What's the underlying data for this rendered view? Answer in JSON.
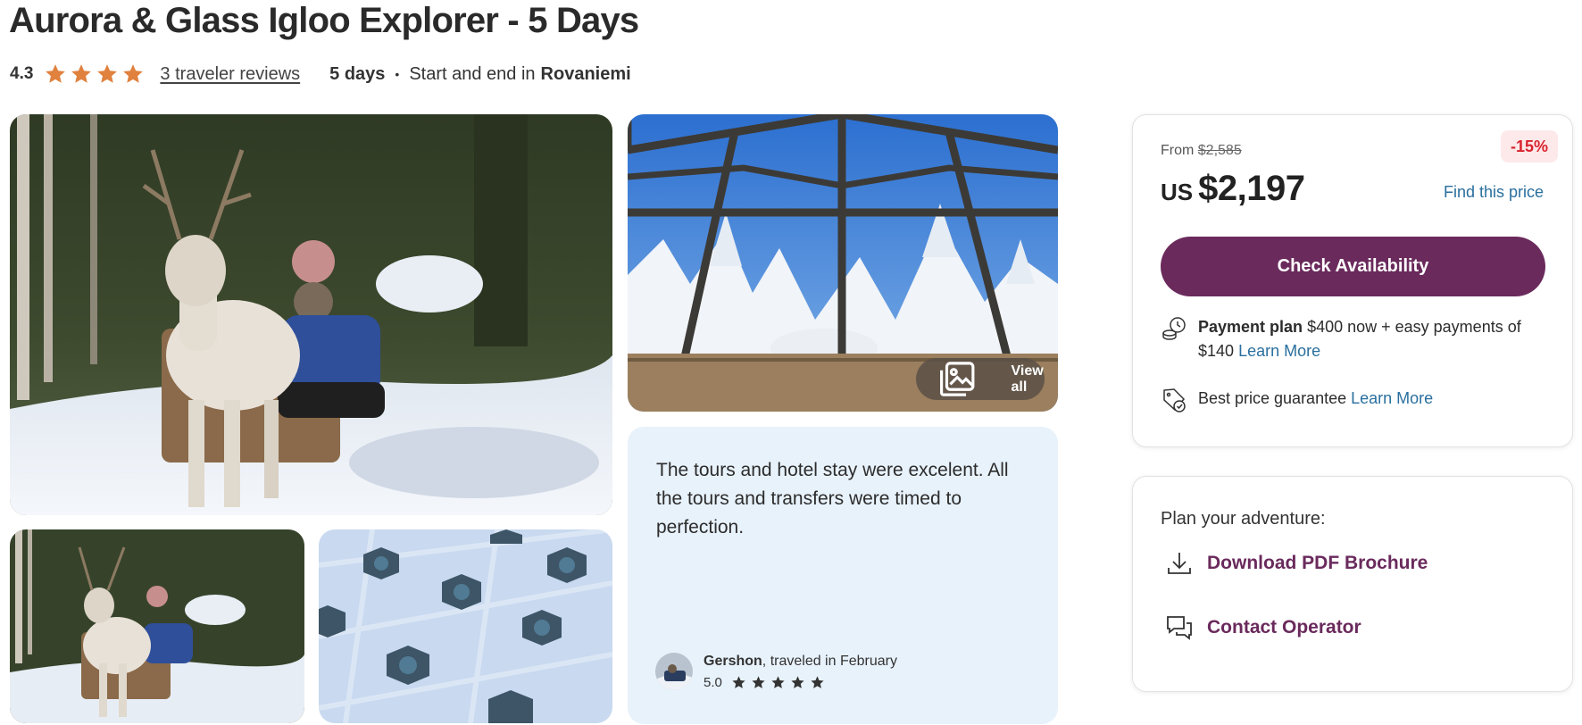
{
  "title": "Aurora & Glass Igloo Explorer - 5 Days",
  "meta": {
    "rating": "4.3",
    "reviews_link": "3 traveler reviews",
    "duration": "5 days",
    "start_end_prefix": "Start and end in",
    "city": "Rovaniemi",
    "star_color": "#e0813e"
  },
  "gallery": {
    "view_all_label": "View all"
  },
  "review": {
    "text": "The tours and hotel stay were excelent. All the tours and transfers were timed to perfection.",
    "reviewer_name": "Gershon",
    "reviewer_suffix": ", traveled in February",
    "reviewer_rating": "5.0"
  },
  "pricing": {
    "from_label": "From",
    "original_price": "$2,585",
    "discount": "-15%",
    "currency_prefix": "US",
    "price": "$2,197",
    "find_price_label": "Find this price",
    "check_button": "Check Availability",
    "payment_plan_title": "Payment plan",
    "payment_plan_text": "$400 now + easy payments of $140",
    "payment_learn_more": "Learn More",
    "guarantee_text": "Best price guarantee",
    "guarantee_learn_more": "Learn More",
    "brand_color": "#6a2a5c",
    "link_color": "#2a6f9e"
  },
  "plan": {
    "label": "Plan your adventure:",
    "download_label": "Download PDF Brochure",
    "contact_label": "Contact Operator"
  }
}
